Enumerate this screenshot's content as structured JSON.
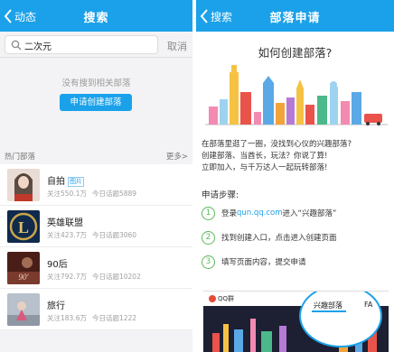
{
  "left": {
    "nav": {
      "back": "动态",
      "title": "搜索"
    },
    "search": {
      "value": "二次元",
      "cancel": "取消"
    },
    "empty": {
      "message": "没有搜到相关部落",
      "create_button": "申请创建部落"
    },
    "hot": {
      "title": "热门部落",
      "more": "更多>",
      "items": [
        {
          "name": "自拍",
          "tag": "图片",
          "followers": "关注550.1万",
          "topics": "今日话题5889",
          "thumb_color": "#d9c8c0"
        },
        {
          "name": "英雄联盟",
          "tag": "",
          "followers": "关注423.7万",
          "topics": "今日话题3060",
          "thumb_color": "#1c3d6e"
        },
        {
          "name": "90后",
          "tag": "",
          "followers": "关注792.7万",
          "topics": "今日话题10202",
          "thumb_color": "#5a2a24"
        },
        {
          "name": "旅行",
          "tag": "",
          "followers": "关注183.6万",
          "topics": "今日话题1222",
          "thumb_color": "#a8b0bb"
        }
      ]
    }
  },
  "right": {
    "nav": {
      "back": "搜索",
      "title": "部落申请"
    },
    "heading": "如何创建部落?",
    "description": [
      "在部落里逛了一圈，没找到心仪的兴趣部落?",
      "创建部落、当酋长，玩法？你说了算!",
      "立即加入，与千万达人一起玩转部落!"
    ],
    "steps_title": "申请步骤:",
    "steps": [
      {
        "num": "1",
        "pre": "登录",
        "link": "qun.qq.com",
        "post": "进入“兴趣部落”"
      },
      {
        "num": "2",
        "pre": "找到创建入口，点击进入创建页面",
        "link": "",
        "post": ""
      },
      {
        "num": "3",
        "pre": "填写页面内容，提交申请",
        "link": "",
        "post": ""
      }
    ],
    "preview": {
      "logo": "QQ群",
      "tab": "兴趣部落",
      "fa": "FA"
    }
  },
  "colors": {
    "accent": "#1aa1ea",
    "step_green": "#5cb85c"
  }
}
